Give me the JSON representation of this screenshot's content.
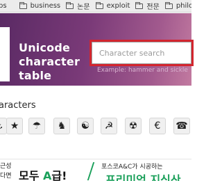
{
  "bookmarks": [
    {
      "label": "ps",
      "icon": "folder-icon"
    },
    {
      "label": "business",
      "icon": "folder-icon"
    },
    {
      "label": "논문",
      "icon": "folder-icon"
    },
    {
      "label": "exploit",
      "icon": "folder-icon"
    },
    {
      "label": "전문",
      "icon": "folder-icon"
    },
    {
      "label": "philosop",
      "icon": "folder-icon"
    }
  ],
  "header": {
    "title_lines": [
      "Unicode",
      "character",
      "table"
    ],
    "search": {
      "placeholder": "Character search",
      "value": "",
      "example": "Example: hammer and sickle"
    },
    "colors": {
      "highlight_border": "#d3252e",
      "banner": "#7a3a78"
    }
  },
  "section": {
    "title": "aracters",
    "chars": [
      "⚓",
      "★",
      "☂",
      "♞",
      "☯",
      "☭",
      "☢",
      "€",
      "☎"
    ]
  },
  "ad": {
    "left_top": "근성",
    "left_bottom": "다면",
    "headline_prefix": "모두 ",
    "headline_highlight": "A",
    "headline_suffix": "급!",
    "right_top": "포스코A&C가 시공하는",
    "right_bottom": "프리미엄 지식산"
  }
}
